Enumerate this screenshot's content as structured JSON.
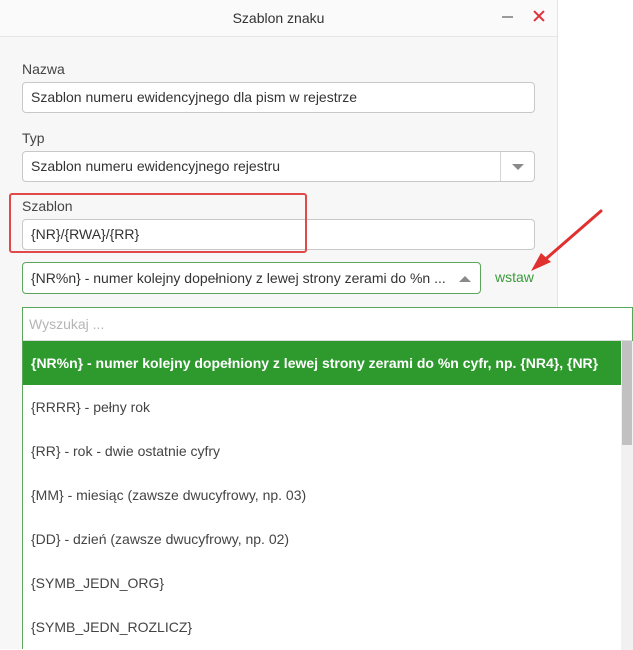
{
  "dialog": {
    "title": "Szablon znaku",
    "name_label": "Nazwa",
    "name_value": "Szablon numeru ewidencyjnego dla pism w rejestrze",
    "type_label": "Typ",
    "type_value": "Szablon numeru ewidencyjnego rejestru",
    "template_label": "Szablon",
    "template_value": "{NR}/{RWA}/{RR}",
    "placeholder_select_value": "{NR%n} - numer kolejny dopełniony z lewej strony zerami do %n ...",
    "insert_label": "wstaw"
  },
  "dropdown": {
    "search_placeholder": "Wyszukaj ...",
    "items": [
      "{NR%n} - numer kolejny dopełniony z lewej strony zerami do %n cyfr, np. {NR4}, {NR}",
      "{RRRR} - pełny rok",
      "{RR} - rok - dwie ostatnie cyfry",
      "{MM} - miesiąc (zawsze dwucyfrowy, np. 03)",
      "{DD} - dzień (zawsze dwucyfrowy, np. 02)",
      "{SYMB_JEDN_ORG}",
      "{SYMB_JEDN_ROZLICZ}"
    ],
    "selected_index": 0
  },
  "colors": {
    "accent_green": "#2e9a2e",
    "close_red": "#e0303a",
    "annotation_red": "#e04a4a"
  },
  "icons": [
    "minimize-icon",
    "close-icon",
    "chevron-down-icon",
    "chevron-up-icon"
  ]
}
